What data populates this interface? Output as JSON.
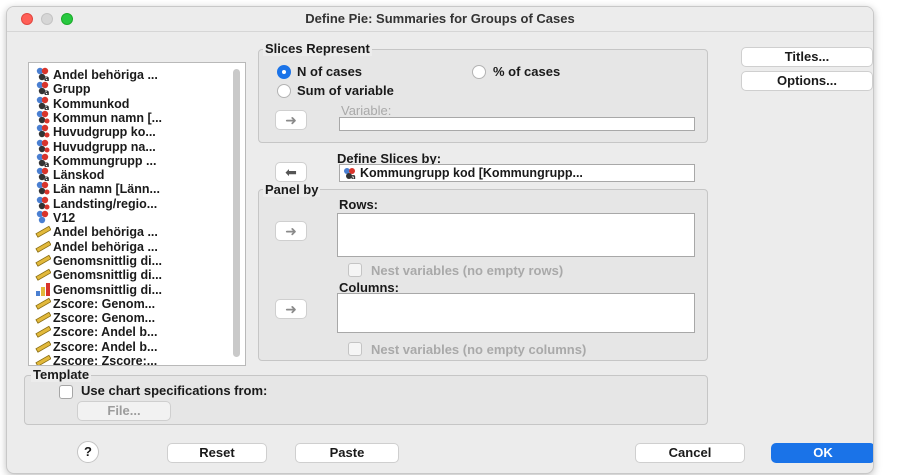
{
  "window": {
    "title": "Define Pie: Summaries for Groups of Cases"
  },
  "variables": [
    {
      "label": "Andel behöriga ...",
      "icon": "nominal-string-icon"
    },
    {
      "label": "Grupp",
      "icon": "nominal-string-icon"
    },
    {
      "label": "Kommunkod",
      "icon": "nominal-string-icon"
    },
    {
      "label": "Kommun namn [...",
      "icon": "nominal-icon"
    },
    {
      "label": "Huvudgrupp ko...",
      "icon": "nominal-icon"
    },
    {
      "label": "Huvudgrupp na...",
      "icon": "nominal-icon"
    },
    {
      "label": "Kommungrupp ...",
      "icon": "nominal-string-icon"
    },
    {
      "label": "Länskod",
      "icon": "nominal-string-icon"
    },
    {
      "label": "Län namn [Länn...",
      "icon": "nominal-icon"
    },
    {
      "label": "Landsting/regio...",
      "icon": "nominal-icon"
    },
    {
      "label": "V12",
      "icon": "nominal-blue-icon"
    },
    {
      "label": "Andel behöriga ...",
      "icon": "scale-ruler-icon"
    },
    {
      "label": "Andel behöriga ...",
      "icon": "scale-ruler-icon"
    },
    {
      "label": "Genomsnittlig di...",
      "icon": "scale-ruler-icon"
    },
    {
      "label": "Genomsnittlig di...",
      "icon": "scale-ruler-icon"
    },
    {
      "label": "Genomsnittlig di...",
      "icon": "ordinal-bars-icon"
    },
    {
      "label": "Zscore:  Genom...",
      "icon": "scale-ruler-icon"
    },
    {
      "label": "Zscore:  Genom...",
      "icon": "scale-ruler-icon"
    },
    {
      "label": "Zscore:  Andel b...",
      "icon": "scale-ruler-icon"
    },
    {
      "label": "Zscore:  Andel b...",
      "icon": "scale-ruler-icon"
    },
    {
      "label": "Zscore:  Zscore:...",
      "icon": "scale-ruler-icon"
    }
  ],
  "slices": {
    "group_label": "Slices Represent",
    "n_cases": "N of cases",
    "pct_cases": "% of cases",
    "sum_var": "Sum of variable",
    "variable_label": "Variable:",
    "variable_value": ""
  },
  "define_slices": {
    "label": "Define Slices by:",
    "value": "Kommungrupp kod [Kommungrupp..."
  },
  "panel": {
    "group_label": "Panel by",
    "rows_label": "Rows:",
    "nest_rows": "Nest variables (no empty rows)",
    "columns_label": "Columns:",
    "nest_columns": "Nest variables (no empty columns)"
  },
  "template": {
    "group_label": "Template",
    "use_spec": "Use chart specifications from:",
    "file_button": "File..."
  },
  "side_buttons": {
    "titles": "Titles...",
    "options": "Options..."
  },
  "bottom_buttons": {
    "help": "?",
    "reset": "Reset",
    "paste": "Paste",
    "cancel": "Cancel",
    "ok": "OK"
  },
  "colors": {
    "accent": "#1a73e8",
    "close": "#ff5f57",
    "maximize": "#28c840"
  }
}
